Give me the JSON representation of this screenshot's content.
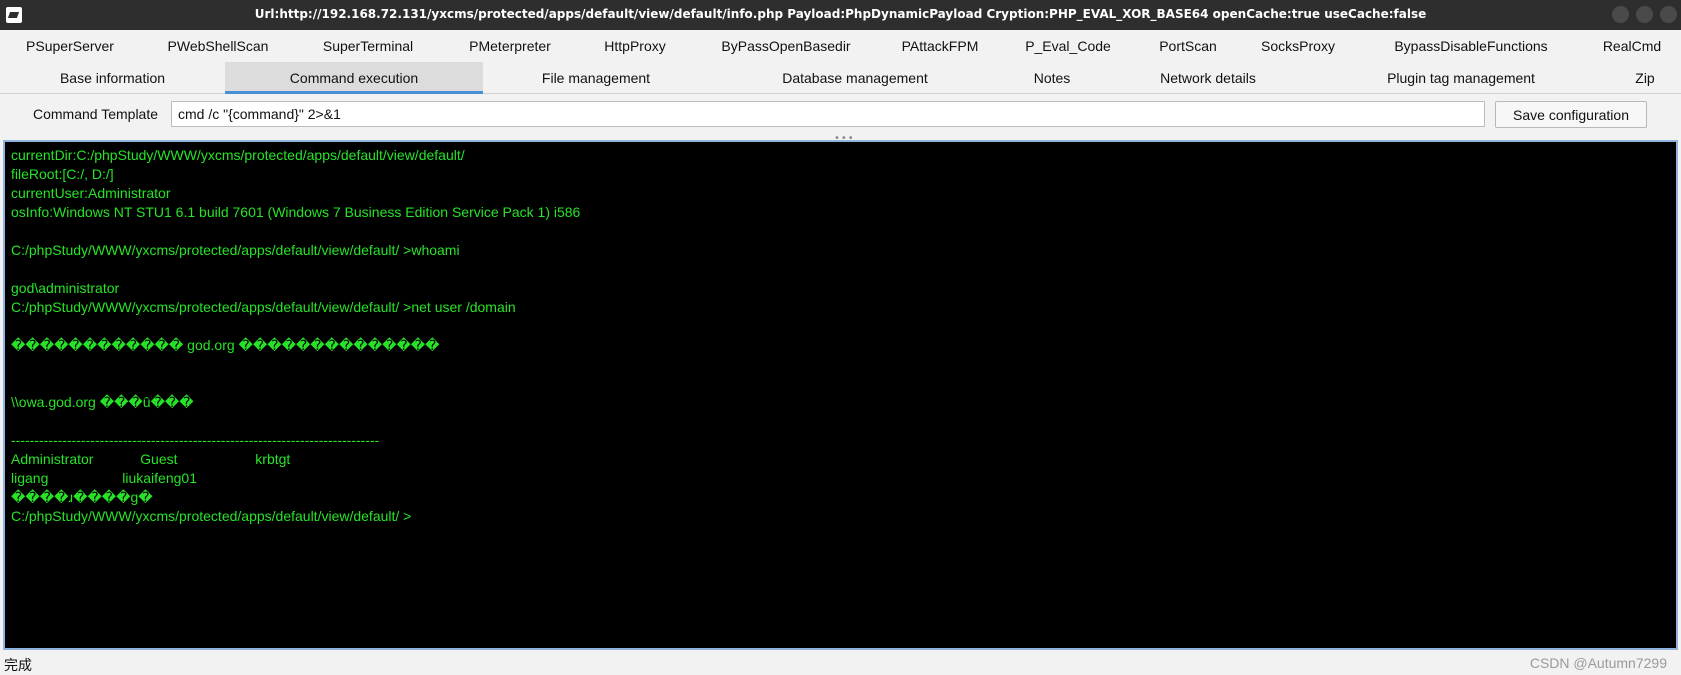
{
  "window": {
    "title": "Url:http://192.168.72.131/yxcms/protected/apps/default/view/default/info.php Payload:PhpDynamicPayload Cryption:PHP_EVAL_XOR_BASE64 openCache:true useCache:false"
  },
  "plugin_tabs": [
    "PSuperServer",
    "PWebShellScan",
    "SuperTerminal",
    "PMeterpreter",
    "HttpProxy",
    "ByPassOpenBasedir",
    "PAttackFPM",
    "P_Eval_Code",
    "PortScan",
    "SocksProxy",
    "BypassDisableFunctions",
    "RealCmd"
  ],
  "main_tabs": [
    "Base information",
    "Command execution",
    "File management",
    "Database management",
    "Notes",
    "Network details",
    "Plugin tag management",
    "Zip"
  ],
  "active_main_tab": "Command execution",
  "command_template": {
    "label": "Command Template",
    "value": "cmd /c \"{command}\" 2>&1"
  },
  "save_button": {
    "label": "Save configuration"
  },
  "console": {
    "text_color": "#27e327",
    "lines": [
      "currentDir:C:/phpStudy/WWW/yxcms/protected/apps/default/view/default/",
      "fileRoot:[C:/, D:/]",
      "currentUser:Administrator",
      "osInfo:Windows NT STU1 6.1 build 7601 (Windows 7 Business Edition Service Pack 1) i586",
      "",
      "C:/phpStudy/WWW/yxcms/protected/apps/default/view/default/ >whoami",
      "",
      "god\\administrator",
      "C:/phpStudy/WWW/yxcms/protected/apps/default/view/default/ >net user /domain",
      "",
      "������������ god.org ��������������",
      "",
      "",
      "\\\\owa.god.org ���û���",
      "",
      "-------------------------------------------------------------------------------",
      "Administrator            Guest                    krbtgt",
      "ligang                   liukaifeng01",
      "����ɹ����g�",
      "C:/phpStudy/WWW/yxcms/protected/apps/default/view/default/ >"
    ]
  },
  "status": {
    "text": "完成"
  },
  "watermark": "CSDN @Autumn7299"
}
